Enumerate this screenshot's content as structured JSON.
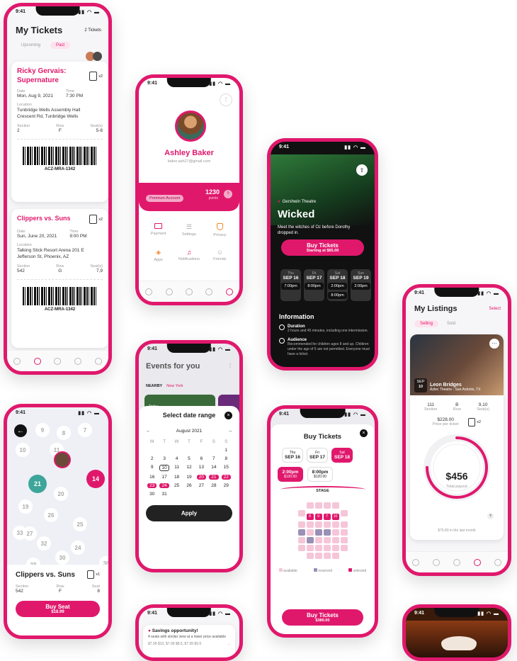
{
  "colors": {
    "accent": "#e0186c",
    "dark": "#111111",
    "reserved": "#9a8fb5",
    "available": "#f5c6d8"
  },
  "status_time": "9:41",
  "tickets": {
    "title": "My Tickets",
    "count": "2 Tickets",
    "tab_upcoming": "Upcoming",
    "tab_past": "Past",
    "t1": {
      "name": "Ricky Gervais: Supernature",
      "qty": "x2",
      "date_label": "Date",
      "date": "Mon, Aug 9, 2021",
      "time_label": "Time",
      "time": "7:30 PM",
      "location_label": "Location",
      "location": "Tunbridge Wells Assembly Hall Crescent Rd, Tunbridge Wells",
      "section_label": "Section",
      "section": "2",
      "row_label": "Row",
      "row": "F",
      "seats_label": "Seat(s)",
      "seats": "5-8",
      "code": "ACZ-MRA-1342"
    },
    "t2": {
      "name": "Clippers vs. Suns",
      "qty": "x2",
      "date_label": "Date",
      "date": "Sun, June 20, 2021",
      "time_label": "Time",
      "time": "9:00 PM",
      "location_label": "Location",
      "location": "Talking Stick Resort Arena 201 E Jefferson St, Phoenix, AZ",
      "section_label": "Section",
      "section": "542",
      "row_label": "Row",
      "row": "G",
      "seats_label": "Seat(s)",
      "seats": "7,9",
      "code": "ACZ-MRA-1342"
    }
  },
  "seatmap": {
    "seats": [
      "9",
      "8",
      "7",
      "10",
      "11",
      "21",
      "14",
      "20",
      "19",
      "26",
      "25",
      "27",
      "33",
      "32",
      "38",
      "30",
      "36",
      "24"
    ],
    "title": "Clippers vs. Suns",
    "qty": "x1",
    "section_label": "Section",
    "section": "542",
    "row_label": "Row",
    "row": "F",
    "seat_label": "Seat",
    "seat": "8",
    "button": "Buy Seat",
    "price": "$18.99"
  },
  "profile": {
    "name": "Ashley Baker",
    "email": "baker.ash27@gmail.com",
    "account": "Premium Account",
    "points": "1230",
    "points_label": "points",
    "help": "?",
    "menu": [
      "Payment",
      "Settings",
      "Privacy",
      "Apps",
      "Notifications",
      "Friends"
    ]
  },
  "events": {
    "title": "Events for you",
    "nearby": "NEARBY",
    "city": "New York",
    "today": "Today",
    "modal_title": "Select date range",
    "month": "August 2021",
    "weekdays": [
      "M",
      "T",
      "W",
      "T",
      "F",
      "S",
      "S"
    ],
    "days": [
      "",
      "",
      "",
      "",
      "",
      "",
      "1",
      "2",
      "3",
      "4",
      "5",
      "6",
      "7",
      "8",
      "9",
      "10",
      "11",
      "12",
      "13",
      "14",
      "15",
      "16",
      "17",
      "18",
      "19",
      "20",
      "21",
      "22",
      "23",
      "24",
      "25",
      "26",
      "27",
      "28",
      "29",
      "30",
      "31"
    ],
    "apply": "Apply"
  },
  "wicked": {
    "venue": "Gershwin Theatre",
    "title": "Wicked",
    "desc": "Meet the witches of Oz before Dorothy dropped in.",
    "button": "Buy Tickets",
    "price": "Starting at $65.00",
    "dates": [
      {
        "dow": "Thu",
        "date": "SEP 16",
        "times": [
          "7:00pm"
        ]
      },
      {
        "dow": "Fri",
        "date": "SEP 17",
        "times": [
          "8:00pm"
        ]
      },
      {
        "dow": "Sat",
        "date": "SEP 18",
        "times": [
          "2:00pm",
          "8:00pm"
        ]
      },
      {
        "dow": "Sun",
        "date": "SEP 19",
        "times": [
          "2:00pm"
        ]
      }
    ],
    "info_title": "Information",
    "duration_label": "Duration",
    "duration": "2 hours and 45 minutes, including one intermission.",
    "audience_label": "Audience",
    "audience": "Recommended for children ages 8 and up. Children under the age of 5 are not permitted. Everyone must have a ticket."
  },
  "buy": {
    "title": "Buy Tickets",
    "dates": [
      {
        "dow": "Thu",
        "date": "SEP 16"
      },
      {
        "dow": "Fri",
        "date": "SEP 17"
      },
      {
        "dow": "Sat",
        "date": "SEP 18"
      }
    ],
    "times": [
      {
        "time": "2:00pm",
        "price": "$120.00"
      },
      {
        "time": "8:00pm",
        "price": "$120.00"
      }
    ],
    "stage": "STAGE",
    "selected_seats": [
      "8",
      "9",
      "7",
      "10"
    ],
    "legend": [
      "available",
      "reserved",
      "selected"
    ],
    "button": "Buy Tickets",
    "price": "$380.00"
  },
  "listings": {
    "title": "My Listings",
    "select": "Select",
    "tab_selling": "Selling",
    "tab_sold": "Sold",
    "month": "SEP",
    "day": "10",
    "artist": "Leon Bridges",
    "venue": "Aztec Theatre - San Antonio, TX",
    "section_label": "Section",
    "section": "111",
    "row_label": "Row",
    "row": "B",
    "seats_label": "Seat(s)",
    "seats": "9,10",
    "price": "$228.00",
    "price_label": "Price per ticket",
    "qty": "x2",
    "payout": "$456",
    "payout_label": "Total payout",
    "progress": 0.75,
    "month_note": "$75.89 in the last month"
  },
  "savings": {
    "title": "Savings opportunity!",
    "desc": "4 seats with similar view at a lower price available",
    "row": "$7.99 $10, $7.99 $8.5, $7.99 $9.9"
  }
}
